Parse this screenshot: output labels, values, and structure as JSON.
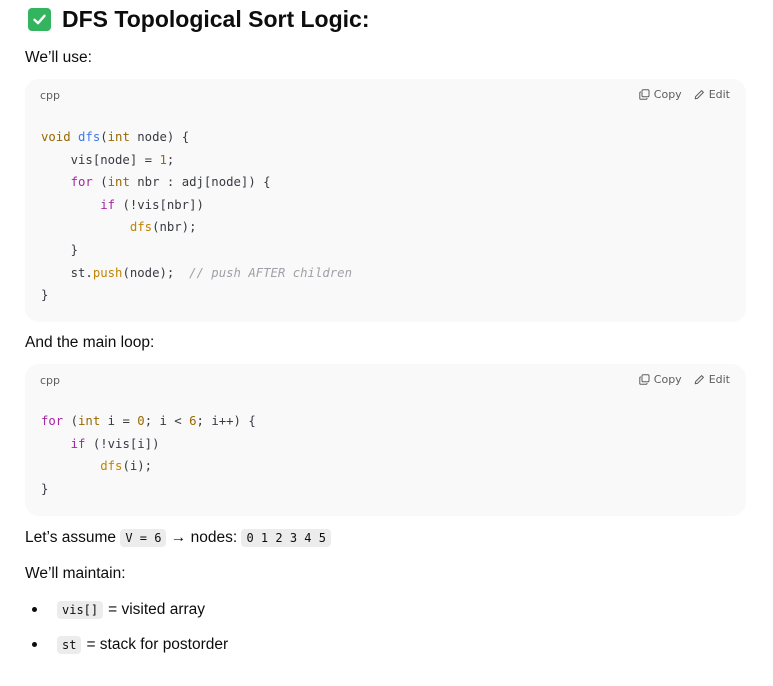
{
  "heading": {
    "icon": "check-mark-icon",
    "text": "DFS Topological Sort Logic:"
  },
  "intro": "We’ll use:",
  "code_block_1": {
    "lang": "cpp",
    "copy_label": "Copy",
    "edit_label": "Edit",
    "lines": [
      "void dfs(int node) {",
      "    vis[node] = 1;",
      "    for (int nbr : adj[node]) {",
      "        if (!vis[nbr])",
      "            dfs(nbr);",
      "    }",
      "    st.push(node);  // push AFTER children",
      "}"
    ]
  },
  "main_loop_text": "And the main loop:",
  "code_block_2": {
    "lang": "cpp",
    "copy_label": "Copy",
    "edit_label": "Edit",
    "lines": [
      "for (int i = 0; i < 6; i++) {",
      "    if (!vis[i])",
      "        dfs(i);",
      "}"
    ]
  },
  "assume": {
    "prefix": "Let’s assume",
    "v_code": "V = 6",
    "middle": "→ nodes:",
    "nodes_code": "0 1 2 3 4 5"
  },
  "maintain_text": "We’ll maintain:",
  "bullets": [
    {
      "code": "vis[]",
      "text": "= visited array"
    },
    {
      "code": "st",
      "text": "= stack for postorder"
    }
  ],
  "colors": {
    "check_green": "#33b55f",
    "code_bg": "#f9f9f9",
    "keyword": "#a626a4",
    "type": "#986801",
    "function": "#4078f2",
    "comment": "#a0a1a7"
  }
}
